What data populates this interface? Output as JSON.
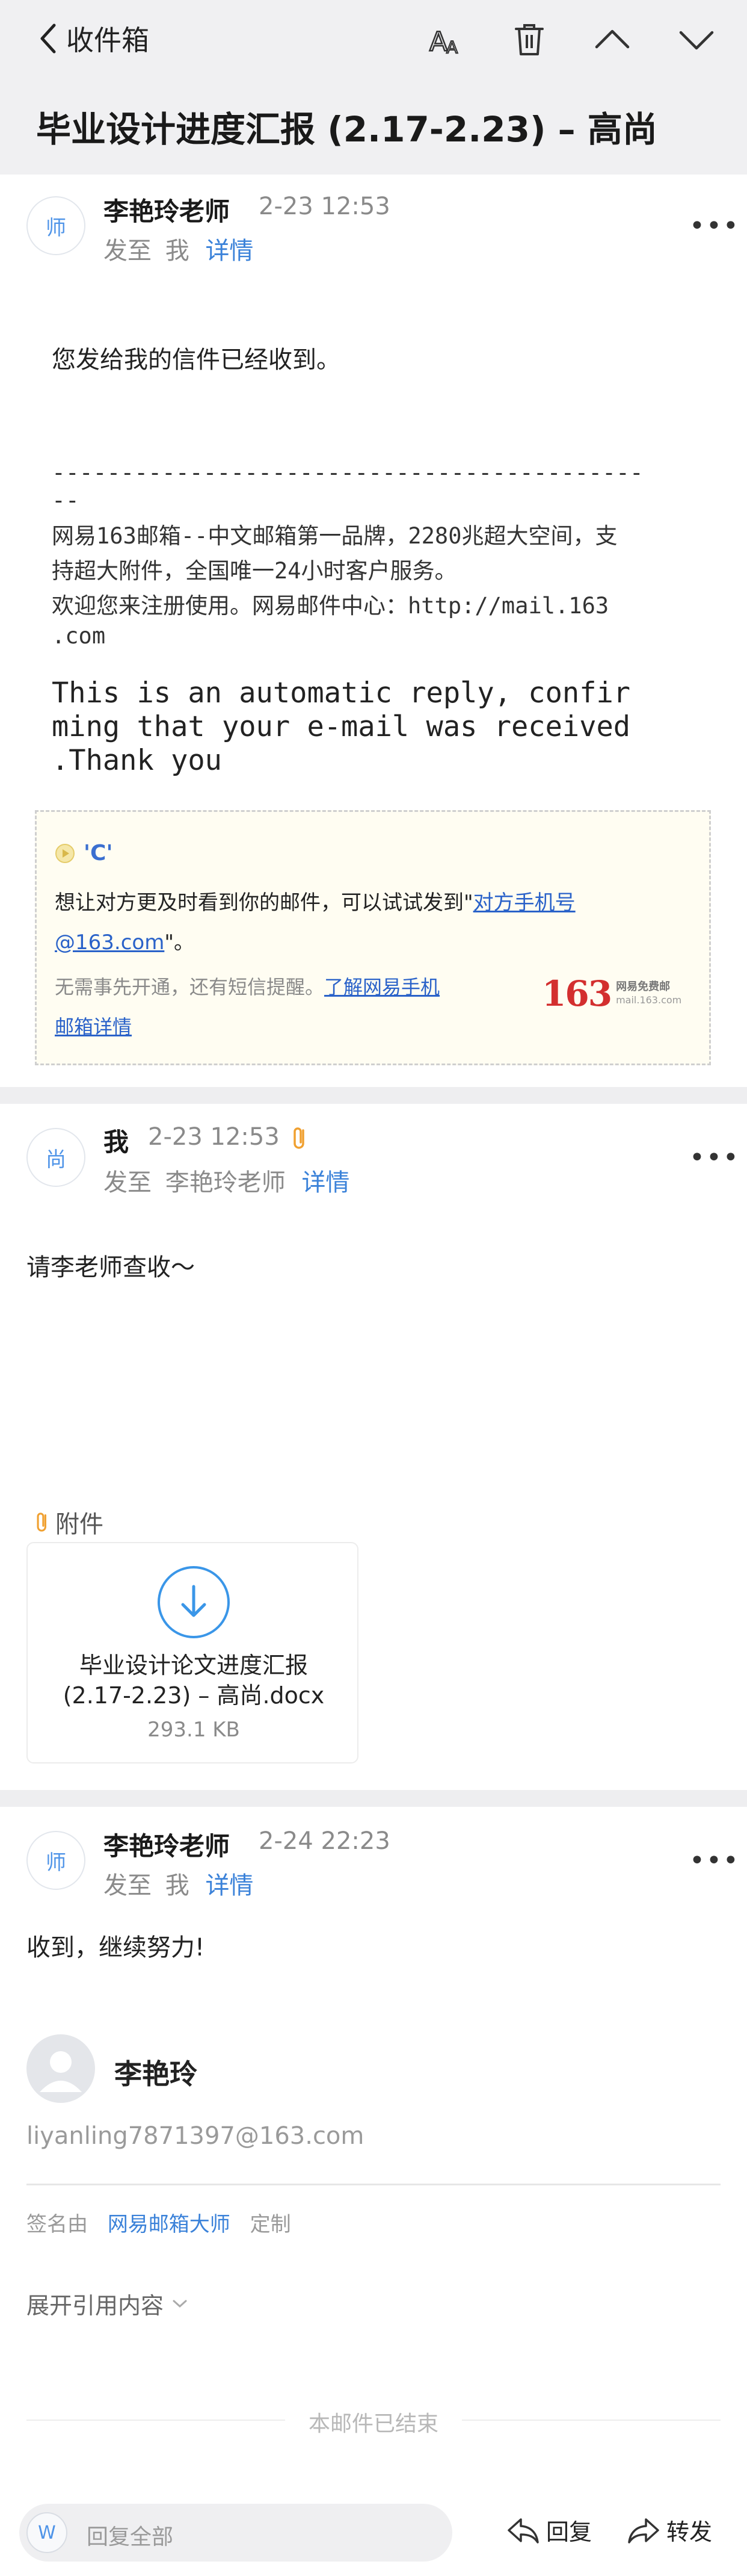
{
  "header": {
    "back_label": "收件箱",
    "subject": "毕业设计进度汇报 (2.17-2.23) – 高尚",
    "tools": [
      "font-size-icon",
      "trash-icon",
      "chevron-up-icon",
      "chevron-down-icon"
    ]
  },
  "messages": [
    {
      "avatar": "师",
      "sender": "李艳玲老师",
      "time": "2-23 12:53",
      "to_prefix": "发至",
      "to": "我",
      "detail_label": "详情",
      "more": "•••",
      "body_lines": [
        "您发给我的信件已经收到。"
      ],
      "footer_rule": "-------------------------------------------",
      "footer_rule_tail": "--",
      "footer_lines": [
        "网易163邮箱--中文邮箱第一品牌，2280兆超大空间，支",
        "持超大附件，全国唯一24小时客户服务。",
        "欢迎您来注册使用。网易邮件中心：http://mail.163",
        ".com"
      ],
      "auto_reply_lines": [
        "This is an automatic reply, confir",
        "ming that your e-mail was received",
        ".Thank you"
      ],
      "notice": {
        "badge": "'C'",
        "line1_text": "想让对方更及时看到你的邮件，可以试试发到\"",
        "line1_link": "对方手机号",
        "line2_link": "@163.com",
        "line2_text": "\"。",
        "line3_text": "无需事先开通，还有短信提醒。",
        "line3_link": "了解网易手机",
        "line4_link": "邮箱详情",
        "logo_number": "163",
        "logo_text": "网易免费邮",
        "logo_domain": "mail.163.com"
      }
    },
    {
      "avatar": "尚",
      "sender": "我",
      "time": "2-23 12:53",
      "to_prefix": "发至",
      "to": "李艳玲老师",
      "detail_label": "详情",
      "more": "•••",
      "body": "请李老师查收～",
      "attachments_label": "附件",
      "attachment": {
        "name_line1": "毕业设计论文进度汇报",
        "name_line2": "(2.17-2.23) – 高尚.docx",
        "size": "293.1 KB"
      }
    },
    {
      "avatar": "师",
      "sender": "李艳玲老师",
      "time": "2-24 22:23",
      "to_prefix": "发至",
      "to": "我",
      "detail_label": "详情",
      "more": "•••",
      "body": "收到，继续努力!",
      "signature": {
        "name": "李艳玲",
        "email": "liyanling7871397@163.com",
        "sign_prefix": "签名由",
        "sign_link": "网易邮箱大师",
        "sign_custom": "定制"
      },
      "expand_label": "展开引用内容",
      "end_label": "本邮件已结束"
    }
  ],
  "bottom": {
    "w_icon": "W",
    "reply_all_placeholder": "回复全部",
    "reply_label": "回复",
    "forward_label": "转发"
  },
  "colors": {
    "accent": "#3b82d9",
    "header_bg": "#f0f0f2",
    "attachment_icon": "#f0a030",
    "logo_red": "#d32f2f"
  }
}
